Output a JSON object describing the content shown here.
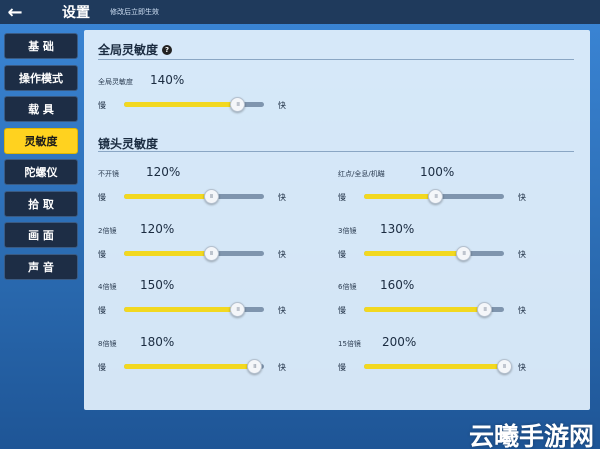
{
  "header": {
    "title": "设置",
    "subtitle": "修改后立即生效",
    "back_icon": "arrow-left-icon"
  },
  "sidebar": {
    "items": [
      {
        "label": "基 础",
        "active": false
      },
      {
        "label": "操作模式",
        "active": false
      },
      {
        "label": "载 具",
        "active": false
      },
      {
        "label": "灵敏度",
        "active": true
      },
      {
        "label": "陀螺仪",
        "active": false
      },
      {
        "label": "拾 取",
        "active": false
      },
      {
        "label": "画 面",
        "active": false
      },
      {
        "label": "声 音",
        "active": false
      }
    ]
  },
  "global": {
    "title": "全局灵敏度",
    "help_icon": "question-icon",
    "label": "全局灵敏度",
    "value": "140%",
    "level": 0.81
  },
  "scope": {
    "title": "镜头灵敏度"
  },
  "sliders": [
    {
      "label": "不开镜",
      "value": "120%",
      "level": 0.62
    },
    {
      "label": "红点/全息/机瞄",
      "value": "100%",
      "level": 0.51
    },
    {
      "label": "2倍镜",
      "value": "120%",
      "level": 0.62
    },
    {
      "label": "3倍镜",
      "value": "130%",
      "level": 0.71
    },
    {
      "label": "4倍镜",
      "value": "150%",
      "level": 0.81
    },
    {
      "label": "6倍镜",
      "value": "160%",
      "level": 0.86
    },
    {
      "label": "8倍镜",
      "value": "180%",
      "level": 0.93
    },
    {
      "label": "15倍镜",
      "value": "200%",
      "level": 1.0
    }
  ],
  "common": {
    "slow": "慢",
    "fast": "快"
  },
  "watermark": "云曦手游网",
  "colors": {
    "accent_yellow": "#ffd21f",
    "slider_fill": "#f2d820",
    "slider_track": "#7f95ae",
    "sidebar_bg": "#1d2d45"
  }
}
